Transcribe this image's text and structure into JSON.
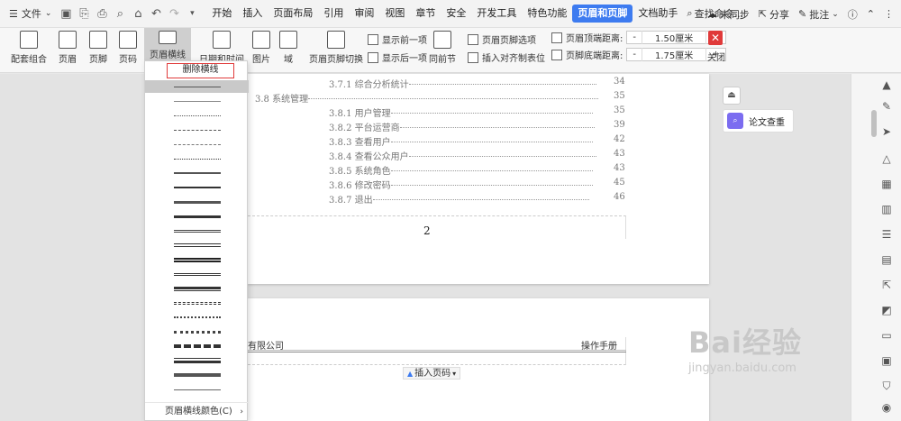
{
  "menubar": {
    "file_label": "文件",
    "tabs": [
      {
        "label": "开始",
        "active": false
      },
      {
        "label": "插入",
        "active": false
      },
      {
        "label": "页面布局",
        "active": false
      },
      {
        "label": "引用",
        "active": false
      },
      {
        "label": "审阅",
        "active": false
      },
      {
        "label": "视图",
        "active": false
      },
      {
        "label": "章节",
        "active": false
      },
      {
        "label": "安全",
        "active": false
      },
      {
        "label": "开发工具",
        "active": false
      },
      {
        "label": "特色功能",
        "active": false
      },
      {
        "label": "页眉和页脚",
        "active": true
      },
      {
        "label": "文档助手",
        "active": false
      }
    ],
    "search_placeholder": "查找命令...",
    "sync_label": "未同步",
    "share_label": "分享",
    "comment_label": "批注"
  },
  "ribbon": {
    "header_combo": "配套组合",
    "header": "页眉",
    "footer": "页脚",
    "page_number": "页码",
    "header_line": "页眉横线",
    "date_time": "日期和时间",
    "picture": "图片",
    "field": "域",
    "switch_hf": "页眉页脚切换",
    "show_prev": "显示前一项",
    "show_next": "显示后一项",
    "same_prev": "同前节",
    "hf_options": "页眉页脚选项",
    "insert_tab": "插入对齐制表位",
    "top_dist_label": "页眉顶端距离:",
    "top_dist_value": "1.50厘米",
    "bottom_dist_label": "页脚底端距离:",
    "bottom_dist_value": "1.75厘米",
    "close": "关闭",
    "minus": "-",
    "plus": "+"
  },
  "dropdown": {
    "delete_label": "删除横线",
    "footer_label": "页眉横线颜色(C)",
    "footer_arrow": "›"
  },
  "toc": [
    {
      "text": "3.7.1 综合分析统计",
      "page": "34",
      "indent": 2
    },
    {
      "text": "3.8 系统管理",
      "page": "35",
      "indent": 1
    },
    {
      "text": "3.8.1 用户管理",
      "page": "35",
      "indent": 2
    },
    {
      "text": "3.8.2 平台运营商",
      "page": "39",
      "indent": 2
    },
    {
      "text": "3.8.3 查看用户",
      "page": "42",
      "indent": 2
    },
    {
      "text": "3.8.4 查看公众用户",
      "page": "43",
      "indent": 2
    },
    {
      "text": "3.8.5 系统角色",
      "page": "43",
      "indent": 2
    },
    {
      "text": "3.8.6 修改密码",
      "page": "45",
      "indent": 2
    },
    {
      "text": "3.8.7 退出",
      "page": "46",
      "indent": 2
    }
  ],
  "page1": {
    "footer_number": "2"
  },
  "page2": {
    "header_left": "有限公司",
    "header_right": "操作手册",
    "insert_page_number": "插入页码"
  },
  "side_panel": {
    "lunwen_label": "论文查重"
  },
  "watermark": {
    "big": "Bai经验",
    "small": "jingyan.baidu.com"
  },
  "colors": {
    "accent": "#3d7bf0",
    "close": "#e03a3a",
    "lunwen": "#7b6cf0"
  }
}
